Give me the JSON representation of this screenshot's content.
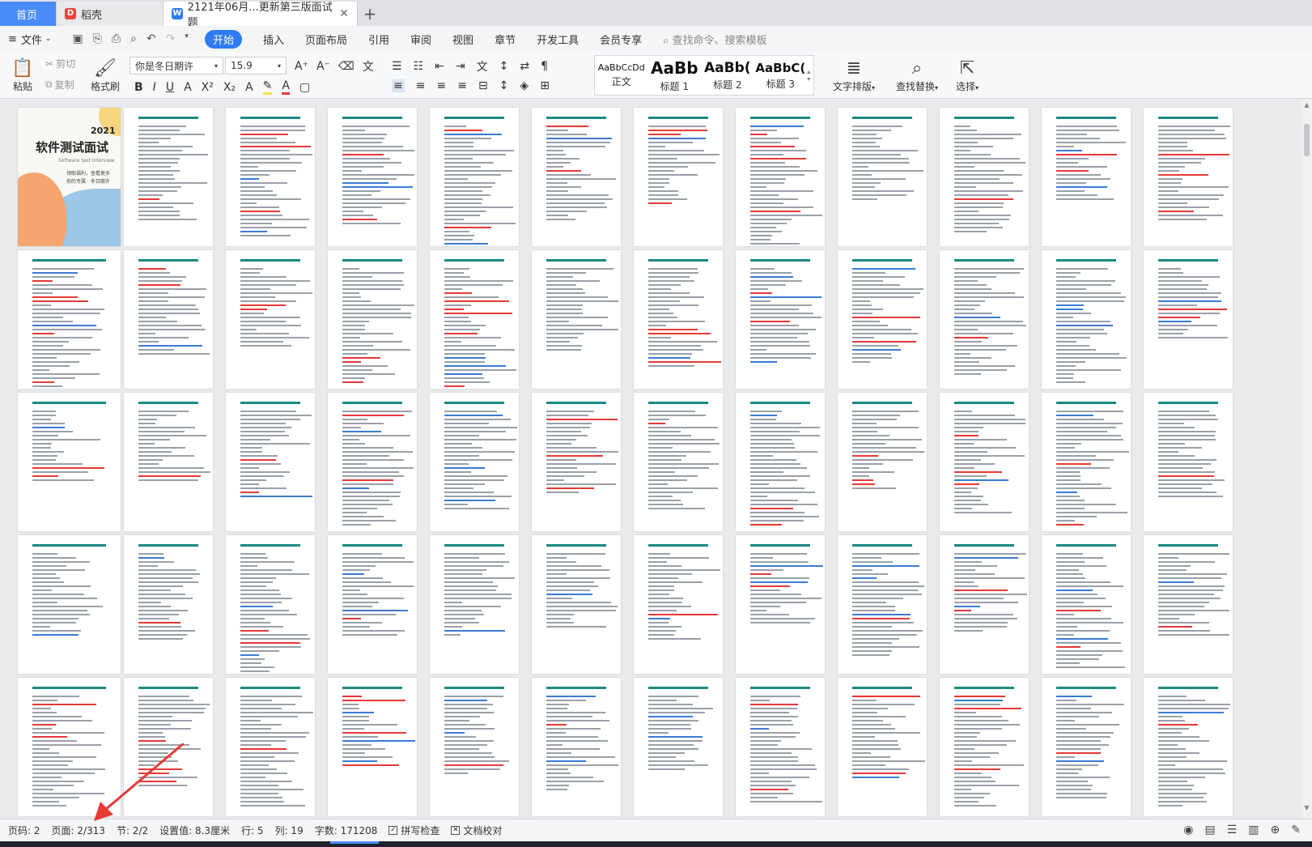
{
  "tabs": {
    "home": "首页",
    "daoke": "稻壳",
    "document": "2121年06月...更新第三版面试题"
  },
  "menu": {
    "file": "文件",
    "items": [
      "开始",
      "插入",
      "页面布局",
      "引用",
      "审阅",
      "视图",
      "章节",
      "开发工具",
      "会员专享"
    ],
    "search_placeholder": "查找命令、搜索模板"
  },
  "ribbon": {
    "cut": "剪切",
    "copy": "复制",
    "paste": "粘贴",
    "format_painter": "格式刷",
    "font_name": "你是冬日期许",
    "font_size": "15.9",
    "styles": [
      {
        "sample": "AaBbCcDd",
        "name": "正文"
      },
      {
        "sample": "AaBb",
        "name": "标题 1"
      },
      {
        "sample": "AaBb(",
        "name": "标题 2"
      },
      {
        "sample": "AaBbC(",
        "name": "标题 3"
      }
    ],
    "text_layout": "文字排版",
    "find_replace": "查找替换",
    "select": "选择"
  },
  "cover": {
    "year": "2021",
    "title": "软件测试面试",
    "subtitle": "Software test interview",
    "line1": "领取福利，查看更多",
    "line2": "你的专属  · 冬日期许"
  },
  "status": {
    "page_code": "页码: 2",
    "page": "页面: 2/313",
    "section": "节: 2/2",
    "setting": "设置值: 8.3厘米",
    "row": "行: 5",
    "col": "列: 19",
    "word_count": "字数: 171208",
    "spell_check": "拼写检查",
    "doc_proof": "文档校对"
  },
  "colors": {
    "accent": "#2f7bf6",
    "home_tab": "#4a8cf7",
    "page_header": "#1a8a80",
    "arrow": "#e53935"
  }
}
